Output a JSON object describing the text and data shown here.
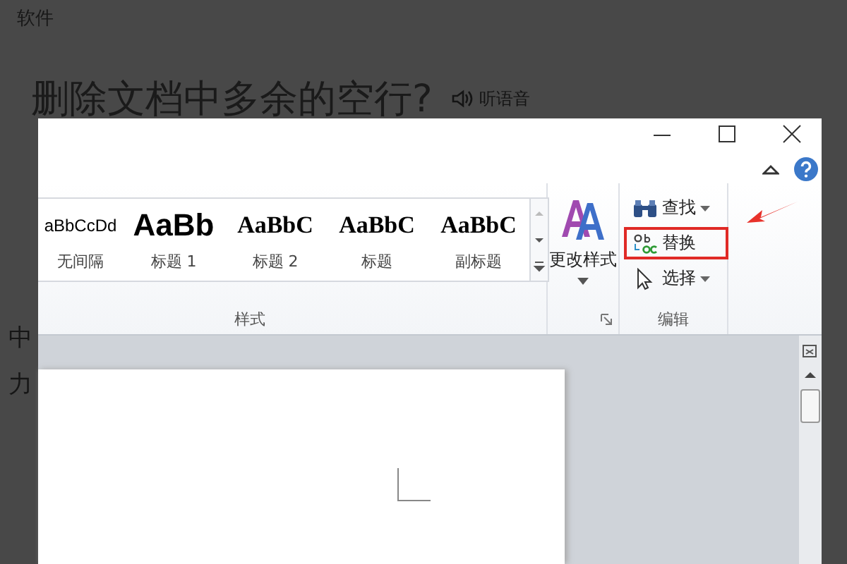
{
  "background_page": {
    "breadcrumb": "软件",
    "title": "删除文档中多余的空行?",
    "listen_label": "听语音",
    "fragments": [
      "中",
      "力"
    ]
  },
  "ribbon": {
    "styles": [
      {
        "preview": "aBbCcDd",
        "name": "无间隔",
        "kind": "plain"
      },
      {
        "preview": "AaBb",
        "name": "标题 1",
        "kind": "heading1"
      },
      {
        "preview": "AaBbC",
        "name": "标题 2",
        "kind": "heading2"
      },
      {
        "preview": "AaBbC",
        "name": "标题",
        "kind": "title"
      },
      {
        "preview": "AaBbC",
        "name": "副标题",
        "kind": "subtitle"
      }
    ],
    "styles_group": "样式",
    "change_styles": "更改样式",
    "editing": [
      {
        "label": "查找",
        "kind": "find",
        "has_menu": true,
        "highlighted": false
      },
      {
        "label": "替换",
        "kind": "replace",
        "has_menu": false,
        "highlighted": true
      },
      {
        "label": "选择",
        "kind": "select",
        "has_menu": true,
        "highlighted": false
      }
    ],
    "editing_group": "编辑"
  }
}
